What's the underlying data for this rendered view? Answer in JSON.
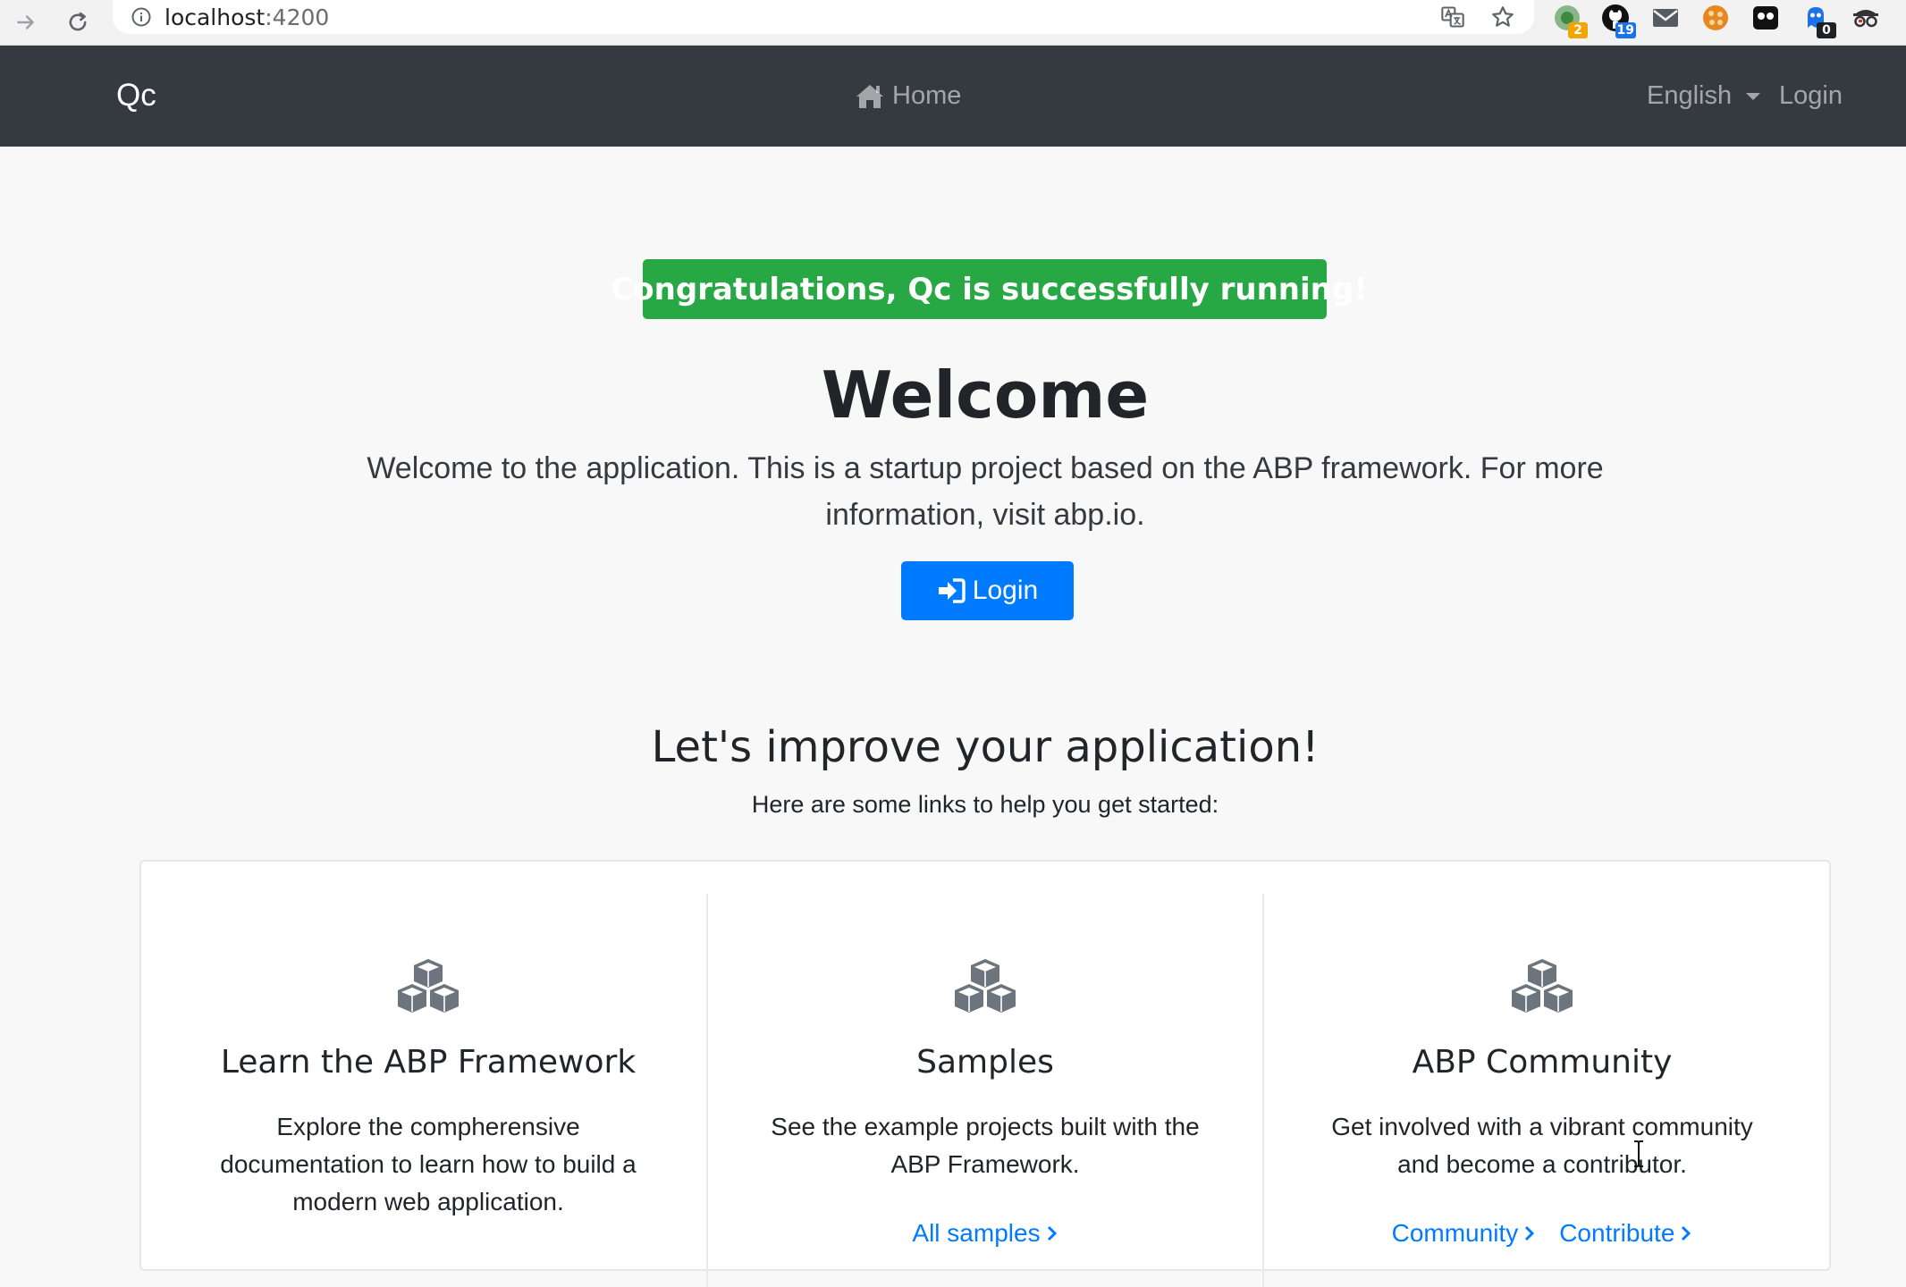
{
  "browser": {
    "url_host": "localhost",
    "url_port": ":4200",
    "extensions": [
      {
        "name": "green-circle-extension-icon",
        "badge": "2",
        "badge_color": "#f0a500"
      },
      {
        "name": "github-extension-icon",
        "badge": "19",
        "badge_color": "#1a73e8"
      },
      {
        "name": "mail-extension-icon",
        "badge": ""
      },
      {
        "name": "orange-cookie-extension-icon",
        "badge": ""
      },
      {
        "name": "black-mask-extension-icon",
        "badge": ""
      },
      {
        "name": "blue-ghost-extension-icon",
        "badge": "0",
        "badge_color": "#202124"
      },
      {
        "name": "incognito-glasses-extension-icon",
        "badge": ""
      }
    ]
  },
  "navbar": {
    "brand": "Qc",
    "home_label": "Home",
    "language_label": "English",
    "login_label": "Login"
  },
  "hero": {
    "badge_prefix": "Congratulations, ",
    "badge_brand": "Qc",
    "badge_suffix": " is successfully running!",
    "title": "Welcome",
    "lead": "Welcome to the application. This is a startup project based on the ABP framework. For more information, visit abp.io.",
    "login_button_label": "Login"
  },
  "improve": {
    "title": "Let's improve your application!",
    "subtitle": "Here are some links to help you get started:",
    "columns": [
      {
        "title": "Learn the ABP Framework",
        "text": "Explore the compherensive documentation to learn how to build a modern web application.",
        "links": []
      },
      {
        "title": "Samples",
        "text": "See the example projects built with the ABP Framework.",
        "links": [
          "All samples"
        ]
      },
      {
        "title": "ABP Community",
        "text": "Get involved with a vibrant community and become a contributor.",
        "links": [
          "Community",
          "Contribute"
        ]
      }
    ]
  },
  "colors": {
    "navbar_bg": "#343a40",
    "success": "#28a745",
    "primary": "#007bff",
    "page_bg": "#f8f8f8",
    "icon_gray": "#6c757d"
  }
}
